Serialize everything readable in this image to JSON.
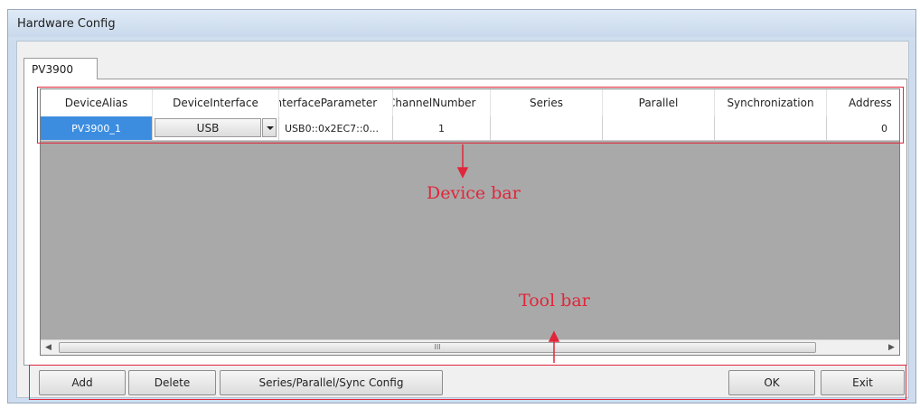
{
  "window": {
    "title": "Hardware Config"
  },
  "tabs": [
    {
      "label": "PV3900"
    }
  ],
  "grid": {
    "columns": [
      "DeviceAlias",
      "DeviceInterface",
      "InterfaceParameter",
      "ChannelNumber",
      "Series",
      "Parallel",
      "Synchronization",
      "Address"
    ],
    "rows": [
      {
        "device_alias": "PV3900_1",
        "device_interface": "USB",
        "interface_parameter": "USB0::0x2EC7::0...",
        "channel_number": "1",
        "series": "",
        "parallel": "",
        "synchronization": "",
        "address": "0"
      }
    ],
    "scroll_thumb_grip": "III"
  },
  "toolbar": {
    "add_label": "Add",
    "delete_label": "Delete",
    "series_config_label": "Series/Parallel/Sync Config",
    "ok_label": "OK",
    "exit_label": "Exit"
  },
  "annotations": {
    "device_bar_label": "Device bar",
    "tool_bar_label": "Tool bar",
    "color": "#e0263a"
  },
  "icons": [
    "dropdown-arrow-icon",
    "scroll-left-icon",
    "scroll-right-icon"
  ]
}
